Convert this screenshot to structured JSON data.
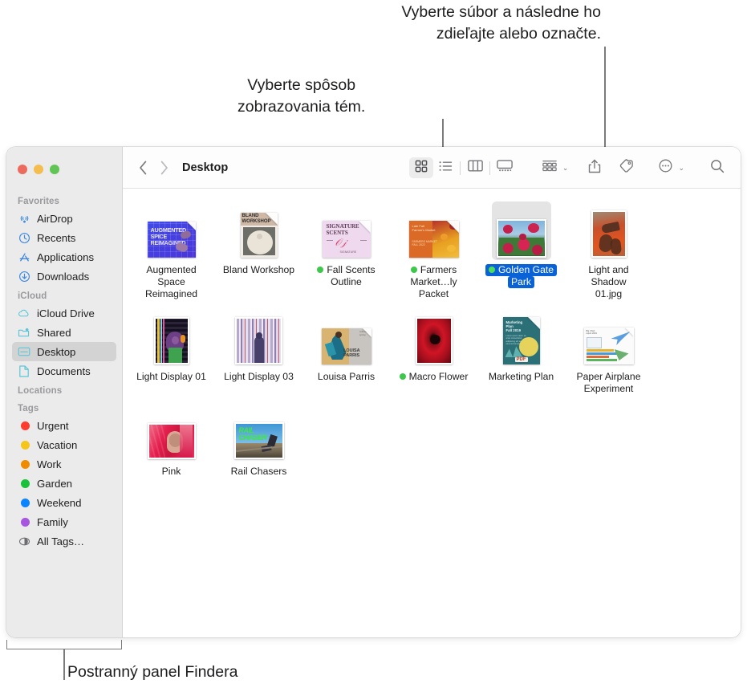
{
  "callouts": {
    "share_tag": "Vyberte súbor a následne ho\nzdieľajte alebo označte.",
    "view_mode": "Vyberte spôsob\nzobrazovania tém.",
    "sidebar": "Postranný panel Findera"
  },
  "window": {
    "traffic_lights": [
      "close",
      "minimize",
      "maximize"
    ]
  },
  "toolbar": {
    "back_label": "‹",
    "forward_label": "›",
    "title": "Desktop",
    "view_buttons": [
      {
        "name": "icon-view",
        "icon": "grid-icon",
        "active": true
      },
      {
        "name": "list-view",
        "icon": "list-icon",
        "active": false
      },
      {
        "name": "column-view",
        "icon": "columns-icon",
        "active": false
      },
      {
        "name": "gallery-view",
        "icon": "gallery-icon",
        "active": false
      }
    ],
    "group_by": "group-icon",
    "share": "share-icon",
    "tag": "tag-icon",
    "more": "ellipsis-icon",
    "search": "search-icon",
    "chevron": "⌄"
  },
  "sidebar": {
    "sections": [
      {
        "title": "Favorites",
        "items": [
          {
            "label": "AirDrop",
            "icon": "airdrop-icon",
            "selected": false
          },
          {
            "label": "Recents",
            "icon": "clock-icon",
            "selected": false
          },
          {
            "label": "Applications",
            "icon": "applications-icon",
            "selected": false
          },
          {
            "label": "Downloads",
            "icon": "download-icon",
            "selected": false
          }
        ]
      },
      {
        "title": "iCloud",
        "items": [
          {
            "label": "iCloud Drive",
            "icon": "cloud-icon",
            "selected": false
          },
          {
            "label": "Shared",
            "icon": "shared-icon",
            "selected": false
          },
          {
            "label": "Desktop",
            "icon": "desktop-icon",
            "selected": true
          },
          {
            "label": "Documents",
            "icon": "document-icon",
            "selected": false
          }
        ]
      },
      {
        "title": "Locations",
        "items": []
      },
      {
        "title": "Tags",
        "items": [
          {
            "label": "Urgent",
            "icon": "tag-dot",
            "color": "#ff3b30",
            "selected": false
          },
          {
            "label": "Vacation",
            "icon": "tag-dot",
            "color": "#f5c518",
            "selected": false
          },
          {
            "label": "Work",
            "icon": "tag-dot",
            "color": "#f08b00",
            "selected": false
          },
          {
            "label": "Garden",
            "icon": "tag-dot",
            "color": "#19c23a",
            "selected": false
          },
          {
            "label": "Weekend",
            "icon": "tag-dot",
            "color": "#0a84ff",
            "selected": false
          },
          {
            "label": "Family",
            "icon": "tag-dot",
            "color": "#a855e0",
            "selected": false
          },
          {
            "label": "All Tags…",
            "icon": "all-tags-icon",
            "color": "",
            "selected": false
          }
        ]
      }
    ]
  },
  "files": [
    {
      "name_lines": [
        "Augmented",
        "Space Reimagined"
      ],
      "tag_dot": "",
      "selected": false,
      "kind": "doc",
      "thumb": "augmented-space"
    },
    {
      "name_lines": [
        "Bland Workshop"
      ],
      "tag_dot": "",
      "selected": false,
      "kind": "doc",
      "thumb": "bland-workshop"
    },
    {
      "name_lines": [
        "Fall Scents",
        "Outline"
      ],
      "tag_dot": "#3fc64c",
      "selected": false,
      "kind": "doc",
      "thumb": "fall-scents"
    },
    {
      "name_lines": [
        "Farmers",
        "Market…ly Packet"
      ],
      "tag_dot": "#3fc64c",
      "selected": false,
      "kind": "doc",
      "thumb": "farmers-market"
    },
    {
      "name_lines": [
        "Golden Gate",
        "Park"
      ],
      "tag_dot": "#4cdd5b",
      "selected": true,
      "kind": "photo",
      "thumb": "golden-gate"
    },
    {
      "name_lines": [
        "Light and Shadow",
        "01.jpg"
      ],
      "tag_dot": "",
      "selected": false,
      "kind": "photo",
      "thumb": "light-shadow"
    },
    {
      "name_lines": [
        "Light Display 01"
      ],
      "tag_dot": "",
      "selected": false,
      "kind": "photo",
      "thumb": "light-display-01"
    },
    {
      "name_lines": [
        "Light Display 03"
      ],
      "tag_dot": "",
      "selected": false,
      "kind": "photo",
      "thumb": "light-display-03"
    },
    {
      "name_lines": [
        "Louisa Parris"
      ],
      "tag_dot": "",
      "selected": false,
      "kind": "photo",
      "thumb": "louisa-parris"
    },
    {
      "name_lines": [
        "Macro Flower"
      ],
      "tag_dot": "#3fc64c",
      "selected": false,
      "kind": "photo",
      "thumb": "macro-flower"
    },
    {
      "name_lines": [
        "Marketing Plan"
      ],
      "tag_dot": "",
      "selected": false,
      "kind": "doc",
      "thumb": "marketing-plan"
    },
    {
      "name_lines": [
        "Paper Airplane",
        "Experiment"
      ],
      "tag_dot": "",
      "selected": false,
      "kind": "doc",
      "thumb": "paper-airplane"
    },
    {
      "name_lines": [
        "Pink"
      ],
      "tag_dot": "",
      "selected": false,
      "kind": "photo",
      "thumb": "pink"
    },
    {
      "name_lines": [
        "Rail Chasers"
      ],
      "tag_dot": "",
      "selected": false,
      "kind": "photo",
      "thumb": "rail-chasers"
    }
  ]
}
